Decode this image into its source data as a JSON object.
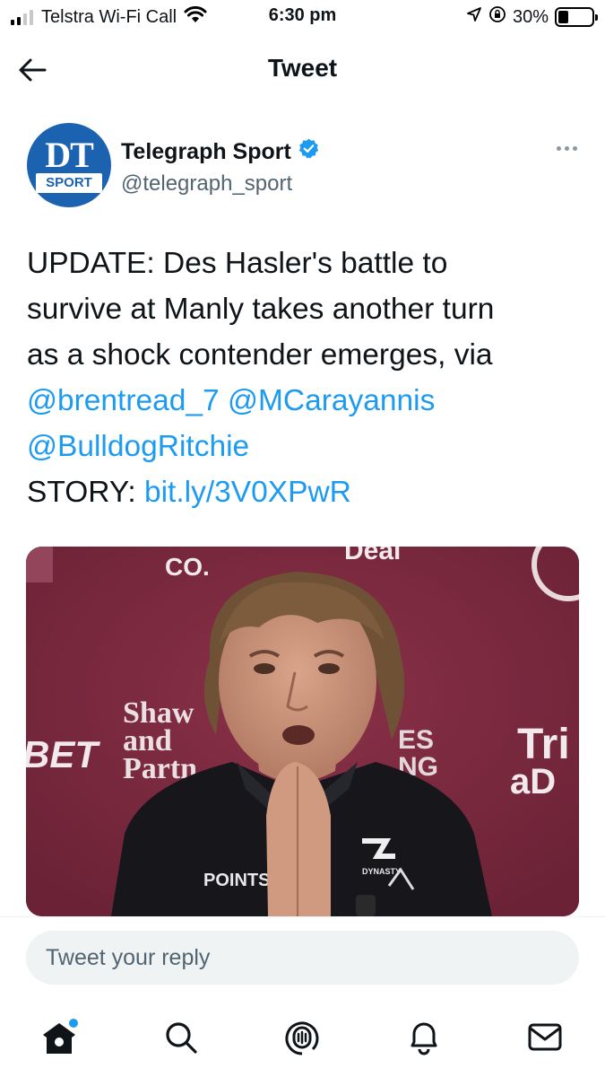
{
  "status_bar": {
    "carrier": "Telstra Wi-Fi Call",
    "time": "6:30 pm",
    "battery": "30%",
    "battery_level": 0.3,
    "icons": [
      "signal-icon",
      "wifi-icon",
      "location-icon",
      "orientation-lock-icon",
      "battery-icon"
    ]
  },
  "nav": {
    "title": "Tweet",
    "back_icon": "back-arrow-icon"
  },
  "tweet": {
    "avatar": {
      "line1": "DT",
      "line2": "SPORT"
    },
    "display_name": "Telegraph Sport",
    "verified": true,
    "handle": "@telegraph_sport",
    "more_icon": "more-icon",
    "text": {
      "line1": "UPDATE: Des Hasler's battle to",
      "line2": "survive at Manly takes another turn",
      "line3": "as a shock contender emerges, via",
      "mention1": "@brentread_7",
      "mention2": "@MCarayannis",
      "mention3": "@BulldogRitchie",
      "story_label": "STORY:",
      "story_link": "bit.ly/3V0XPwR"
    },
    "media": {
      "backdrop_text": {
        "sponsor1": "Shaw",
        "sponsor2": "and",
        "sponsor3": "Partn",
        "left_text": "BET",
        "top_text": "CO.",
        "top_right_text": "Deal",
        "right_text1": "Tri",
        "right_text2": "aD",
        "mid_text1": "ES",
        "mid_text2": "NG"
      },
      "jacket_text": {
        "left": "POINTS",
        "logo": "DYNASTY"
      }
    }
  },
  "reply": {
    "placeholder": "Tweet your reply"
  },
  "tab_bar": {
    "tabs": [
      "home-icon",
      "search-icon",
      "spaces-icon",
      "notifications-icon",
      "messages-icon"
    ]
  },
  "colors": {
    "accent": "#1d9bf0",
    "brand_blue": "#1b63b0",
    "backdrop_maroon": "#7d2a3f"
  }
}
